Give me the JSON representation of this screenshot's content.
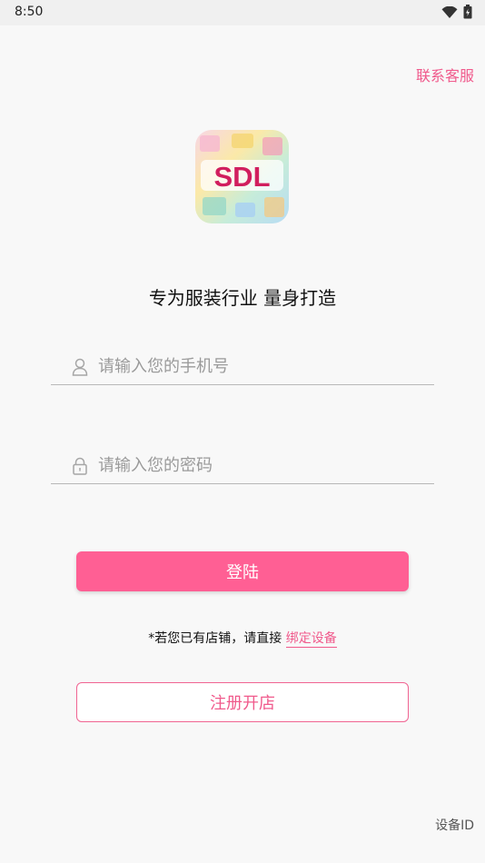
{
  "status_bar": {
    "time": "8:50",
    "icons": [
      "wifi-icon",
      "battery-icon"
    ]
  },
  "header": {
    "contact_label": "联系客服"
  },
  "logo": {
    "text": "SDL"
  },
  "tagline": "专为服装行业 量身打造",
  "form": {
    "phone_placeholder": "请输入您的手机号",
    "phone_value": "",
    "password_placeholder": "请输入您的密码",
    "password_value": ""
  },
  "login_label": "登陆",
  "hint": {
    "prefix": "*若您已有店铺，请直接 ",
    "link": "绑定设备"
  },
  "register_label": "注册开店",
  "device_id_label": "设备ID",
  "colors": {
    "accent": "#ff5f94",
    "link": "#f05a8c",
    "background": "#f8f8f8"
  }
}
